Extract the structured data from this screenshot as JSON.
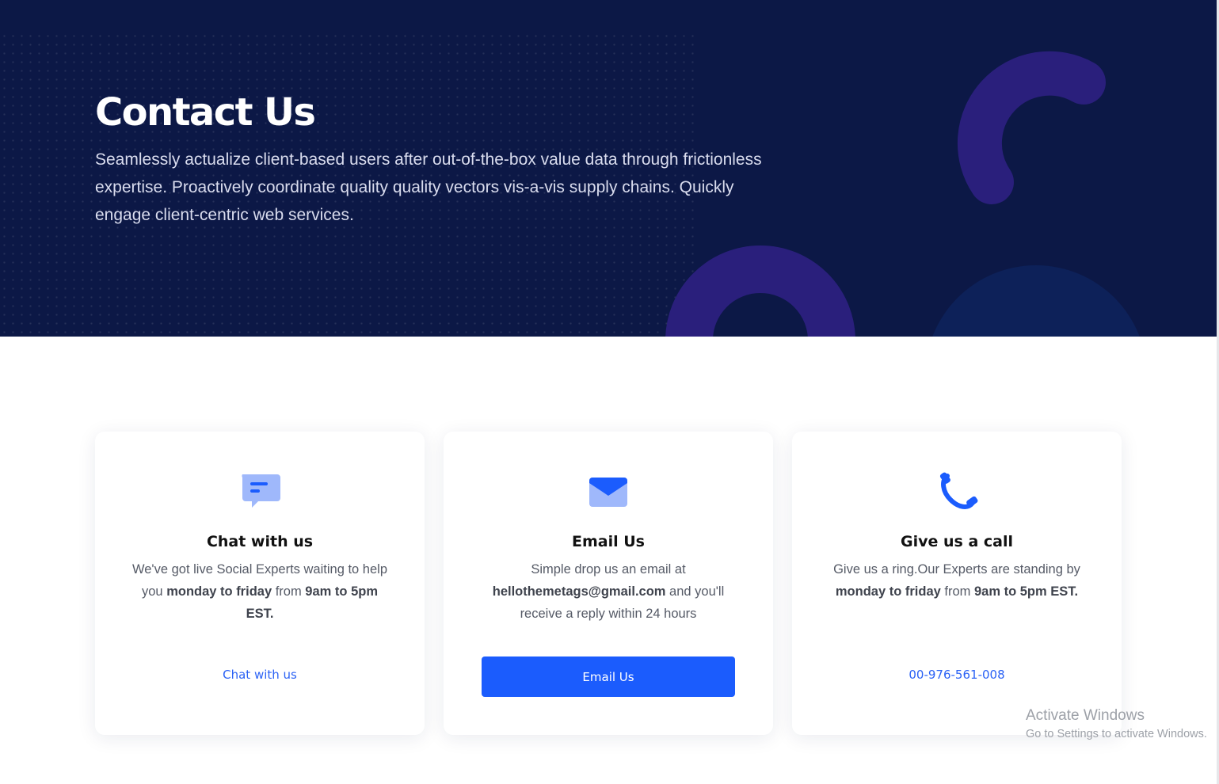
{
  "hero": {
    "title": "Contact Us",
    "description": "Seamlessly actualize client-based users after out-of-the-box value data through frictionless expertise. Proactively coordinate quality quality vectors vis-a-vis supply chains. Quickly engage client-centric web services."
  },
  "cards": [
    {
      "icon": "chat-bubble-icon",
      "title": "Chat with us",
      "desc_parts": [
        "We've got live Social Experts waiting to help you ",
        "monday to friday",
        " from ",
        "9am to 5pm EST."
      ],
      "action_label": "Chat with us"
    },
    {
      "icon": "envelope-icon",
      "title": "Email Us",
      "desc_parts": [
        "Simple drop us an email at ",
        "hellothemetags@gmail.com",
        " and you'll receive a reply within 24 hours"
      ],
      "action_label": "Email Us"
    },
    {
      "icon": "phone-icon",
      "title": "Give us a call",
      "desc_parts": [
        "Give us a ring.Our Experts are standing by ",
        "monday to friday",
        " from ",
        "9am to 5pm EST."
      ],
      "action_label": "00-976-561-008"
    }
  ],
  "watermark": {
    "line1": "Activate Windows",
    "line2": "Go to Settings to activate Windows."
  },
  "colors": {
    "hero_bg": "#0c1846",
    "accent": "#1b5cfd",
    "link": "#2b62f5",
    "shape_purple": "#2a1f7c",
    "shape_navy": "#0d2159"
  }
}
